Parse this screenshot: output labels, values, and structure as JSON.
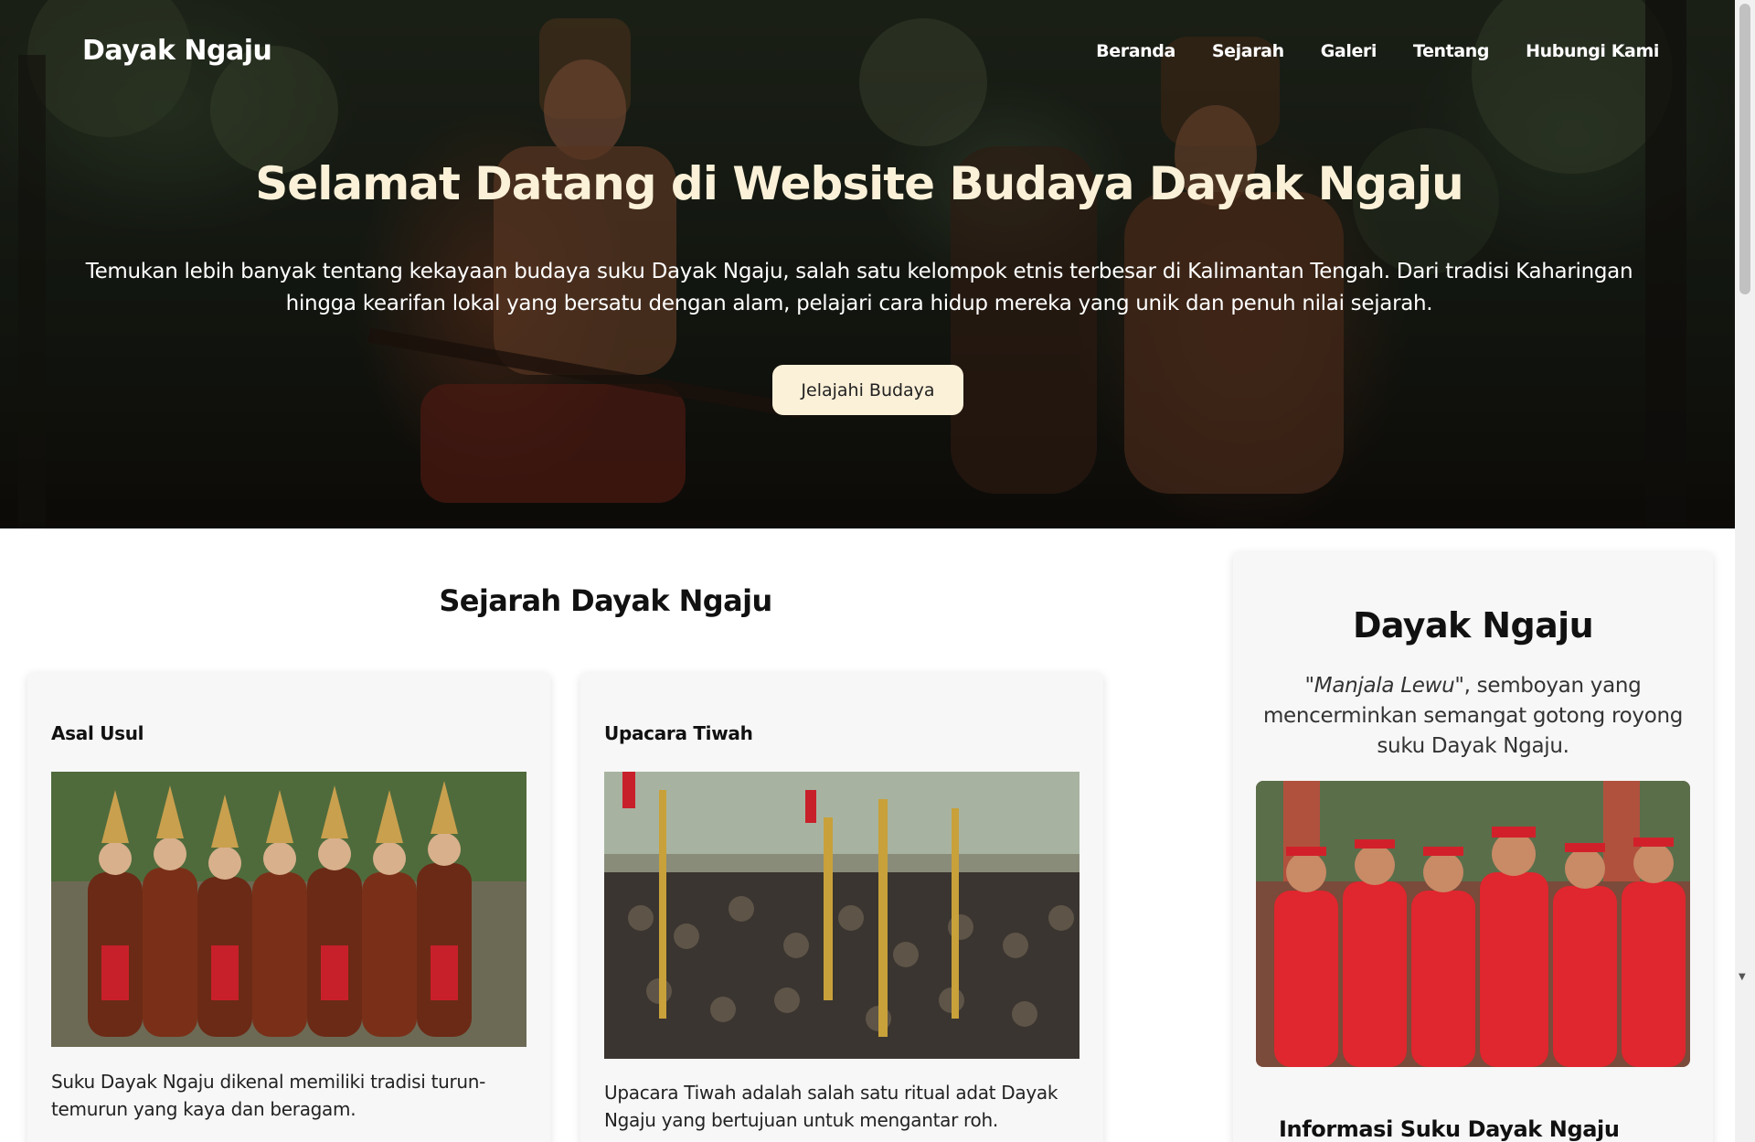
{
  "brand": "Dayak Ngaju",
  "nav": [
    "Beranda",
    "Sejarah",
    "Galeri",
    "Tentang",
    "Hubungi Kami"
  ],
  "hero": {
    "title": "Selamat Datang di Website Budaya Dayak Ngaju",
    "description_line1": "Temukan lebih banyak tentang kekayaan budaya suku Dayak Ngaju, salah satu kelompok etnis terbesar di Kalimantan Tengah. Dari tradisi Kaharingan",
    "description_line2": "hingga kearifan lokal yang bersatu dengan alam, pelajari cara hidup mereka yang unik dan penuh nilai sejarah.",
    "button": "Jelajahi Budaya"
  },
  "history": {
    "title": "Sejarah Dayak Ngaju",
    "cards": [
      {
        "title": "Asal Usul",
        "text": "Suku Dayak Ngaju dikenal memiliki tradisi turun-temurun yang kaya dan beragam."
      },
      {
        "title": "Upacara Tiwah",
        "text": "Upacara Tiwah adalah salah satu ritual adat Dayak Ngaju yang bertujuan untuk mengantar roh."
      }
    ]
  },
  "sidebar": {
    "title": "Dayak Ngaju",
    "motto_quote": "\"Manjala Lewu\"",
    "motto_rest": ", semboyan yang mencerminkan semangat gotong royong suku Dayak Ngaju.",
    "info_title": "Informasi Suku Dayak Ngaju"
  },
  "colors": {
    "hero_title": "#fbf1d8",
    "button_bg": "#fbf0d8",
    "card_bg": "#f7f7f7"
  }
}
